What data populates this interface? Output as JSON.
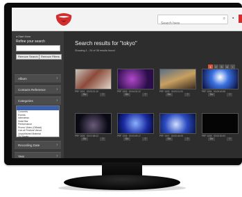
{
  "topbar": {
    "search_placeholder": "Search here",
    "search_icon": "search-icon",
    "user_icon": "user-icon",
    "accent_color": "#d32c2c"
  },
  "sidebar": {
    "back_link": "◂ Start Here",
    "refine_title": "Refine your search",
    "refine_placeholder": "",
    "buttons": [
      "Remove Search",
      "Remove Filters"
    ],
    "sections": [
      {
        "label": "Album"
      },
      {
        "label": "Contacts Reference"
      },
      {
        "label": "Categories"
      },
      {
        "label": "Recording Date"
      },
      {
        "label": "Year"
      }
    ],
    "dropdown": {
      "selected": "",
      "options": [
        "Concerts",
        "Events",
        "Interviews",
        "Hotel Bar",
        "Performance",
        "Promo Video (Official)",
        "Live at Festival Venue",
        "Unpublished Material",
        "TV Studio"
      ]
    }
  },
  "main": {
    "heading": "Search results for \"tokyo\"",
    "subtext": "Showing 1 - 24 of 38 results found",
    "pages": [
      "1",
      "2",
      "3",
      "4",
      "›"
    ],
    "active_page": "1",
    "thumbs": [
      {
        "meta_left": "PRF 1001",
        "meta_right": "00:03:21:10",
        "actions": [
          "Go",
          "?"
        ],
        "tone": "street"
      },
      {
        "meta_left": "PRF 1002",
        "meta_right": "00:04:02:12",
        "actions": [
          "Go",
          "?"
        ],
        "tone": "purple"
      },
      {
        "meta_left": "PRF 1003",
        "meta_right": "00:02:11:03",
        "actions": [
          "Go",
          "?"
        ],
        "tone": "crowd"
      },
      {
        "meta_left": "PRF 1004",
        "meta_right": "00:05:40:08",
        "actions": [
          "Go",
          "?"
        ],
        "tone": "stage"
      },
      {
        "meta_left": "PRF 1005",
        "meta_right": "00:01:58:22",
        "actions": [
          "Go",
          "?"
        ],
        "tone": "dark"
      },
      {
        "meta_left": "PRF 1006",
        "meta_right": "00:03:09:17",
        "actions": [
          "Go",
          "?"
        ],
        "tone": "blue"
      },
      {
        "meta_left": "PRF 1007",
        "meta_right": "00:02:44:05",
        "actions": [
          "Go",
          "?"
        ],
        "tone": "blue2"
      },
      {
        "meta_left": "PRF 1008",
        "meta_right": "00:00:00:00",
        "actions": [
          "Go",
          "?"
        ],
        "tone": "black"
      }
    ]
  }
}
